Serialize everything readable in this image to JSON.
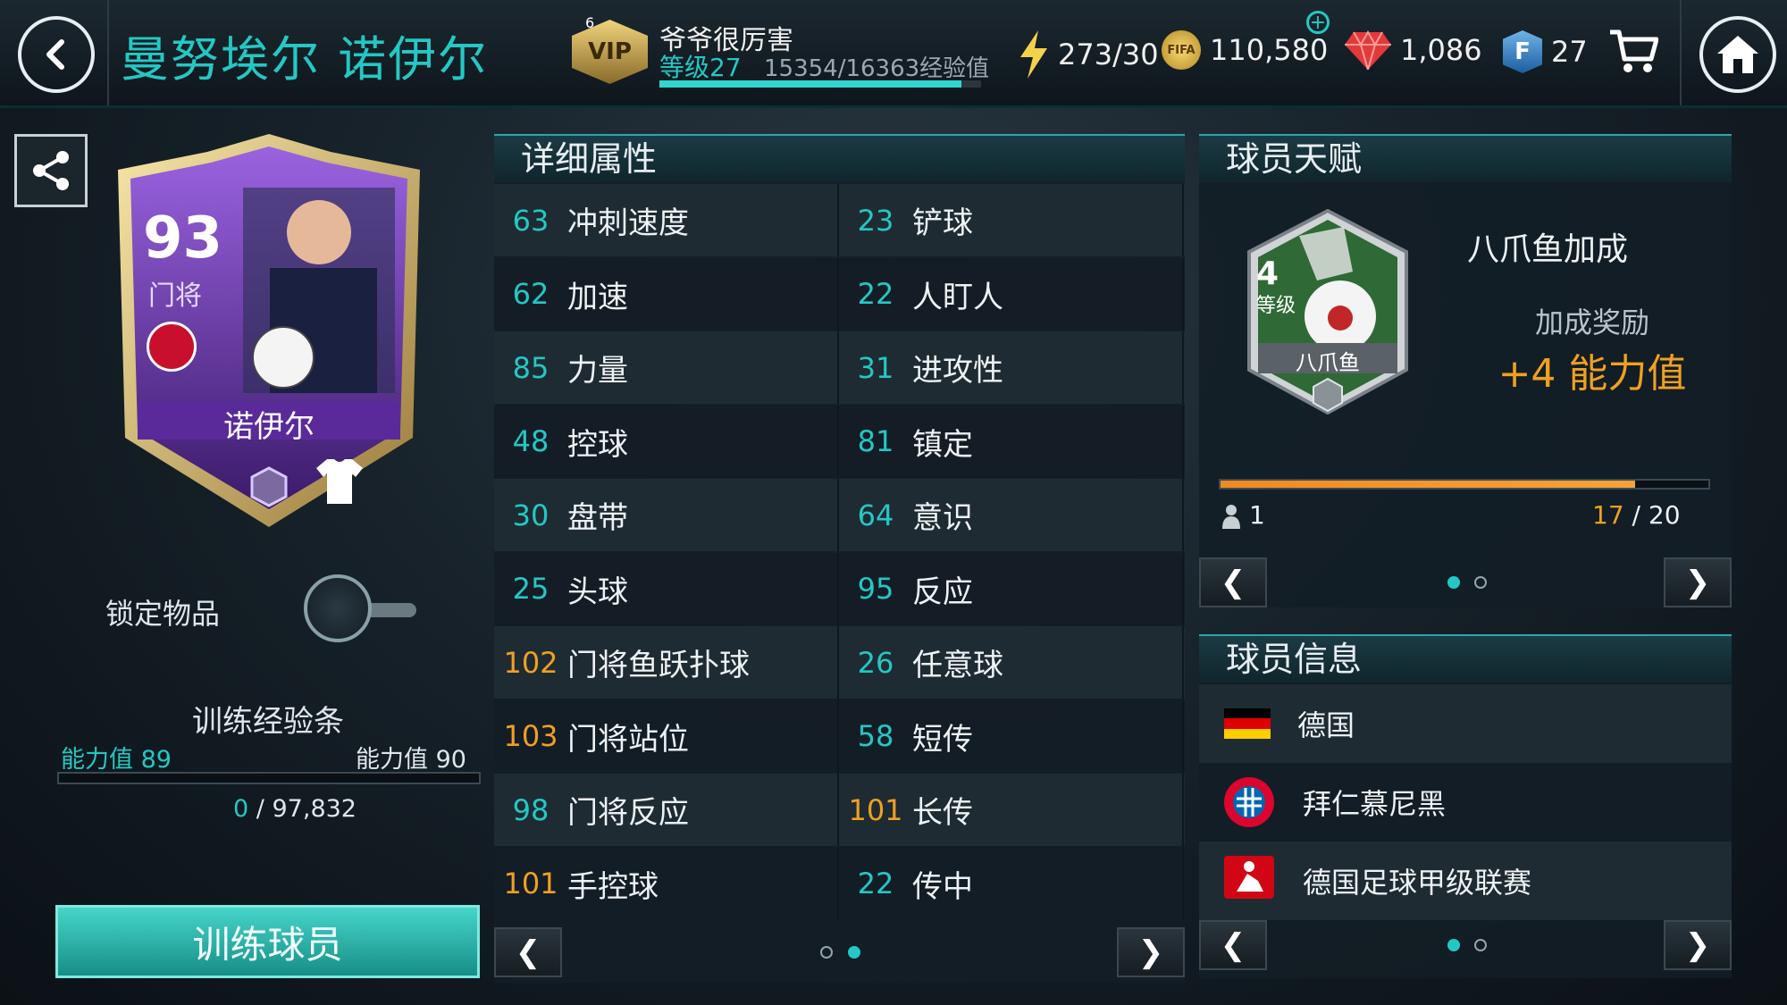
{
  "header": {
    "title": "曼努埃尔 诺伊尔",
    "vip_level": "6",
    "vip_label": "VIP",
    "username": "爷爷很厉害",
    "level_text": "等级27",
    "xp_text": "15354/16363经验值",
    "xp_progress": 0.94,
    "energy": "273/30",
    "coins": "110,580",
    "coin_icon_text": "FIFA",
    "gems": "1,086",
    "fifa_points_letter": "F",
    "fifa_points": "27"
  },
  "card": {
    "rating": "93",
    "position": "门将",
    "name": "诺伊尔"
  },
  "left": {
    "lock_label": "锁定物品",
    "training_bar_label": "训练经验条",
    "ovr_current_label": "能力值",
    "ovr_current": "89",
    "ovr_next_label": "能力值",
    "ovr_next": "90",
    "training_progress_current": "0",
    "training_progress_sep": "/",
    "training_progress_total": "97,832",
    "train_button": "训练球员"
  },
  "attributes": {
    "header": "详细属性",
    "rows": [
      {
        "l_val": "63",
        "l_name": "冲刺速度",
        "r_val": "23",
        "r_name": "铲球"
      },
      {
        "l_val": "62",
        "l_name": "加速",
        "r_val": "22",
        "r_name": "人盯人"
      },
      {
        "l_val": "85",
        "l_name": "力量",
        "r_val": "31",
        "r_name": "进攻性"
      },
      {
        "l_val": "48",
        "l_name": "控球",
        "r_val": "81",
        "r_name": "镇定"
      },
      {
        "l_val": "30",
        "l_name": "盘带",
        "r_val": "64",
        "r_name": "意识"
      },
      {
        "l_val": "25",
        "l_name": "头球",
        "r_val": "95",
        "r_name": "反应"
      },
      {
        "l_val": "102",
        "l_name": "门将鱼跃扑球",
        "r_val": "26",
        "r_name": "任意球"
      },
      {
        "l_val": "103",
        "l_name": "门将站位",
        "r_val": "58",
        "r_name": "短传"
      },
      {
        "l_val": "98",
        "l_name": "门将反应",
        "r_val": "101",
        "r_name": "长传"
      },
      {
        "l_val": "101",
        "l_name": "手控球",
        "r_val": "22",
        "r_name": "传中"
      }
    ]
  },
  "talent": {
    "header": "球员天赋",
    "badge_level": "4",
    "badge_level_label": "等级",
    "badge_name": "八爪鱼",
    "title": "八爪鱼加成",
    "reward_label": "加成奖励",
    "reward_value": "+4 能力值",
    "count": "1",
    "progress_current": "17",
    "progress_sep": "/",
    "progress_total": "20",
    "progress": 0.85
  },
  "info": {
    "header": "球员信息",
    "nation": "德国",
    "club": "拜仁慕尼黑",
    "club_badge_text": "FC BAYERN MÜNCHEN",
    "league": "德国足球甲级联赛"
  },
  "colors": {
    "accent": "#24c8c4",
    "high_value": "#f0a020",
    "reward": "#f0a020"
  }
}
